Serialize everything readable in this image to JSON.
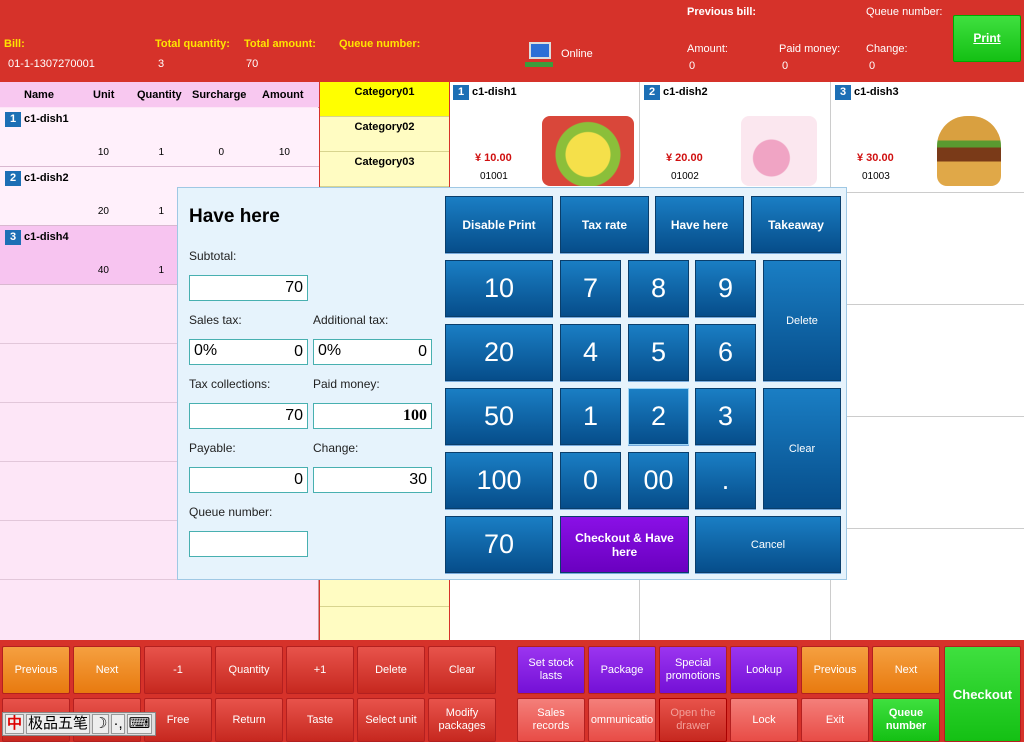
{
  "header": {
    "bill_label": "Bill:",
    "bill_value": "01-1-1307270001",
    "total_quantity_label": "Total quantity:",
    "total_quantity_value": "3",
    "total_amount_label": "Total amount:",
    "total_amount_value": "70",
    "queue_number_label": "Queue number:",
    "status": "Online",
    "previous_bill_label": "Previous bill:",
    "prev_queue_label": "Queue number:",
    "amount_label": "Amount:",
    "amount_value": "0",
    "paid_label": "Paid money:",
    "paid_value": "0",
    "change_label": "Change:",
    "change_value": "0",
    "print_label": "Print"
  },
  "orders": {
    "columns": [
      "Name",
      "Unit",
      "Quantity",
      "Surcharge",
      "Amount"
    ],
    "rows": [
      {
        "index": "1",
        "name": "c1-dish1",
        "unit": "10",
        "quantity": "1",
        "surcharge": "0",
        "amount": "10"
      },
      {
        "index": "2",
        "name": "c1-dish2",
        "unit": "20",
        "quantity": "1"
      },
      {
        "index": "3",
        "name": "c1-dish4",
        "unit": "40",
        "quantity": "1"
      }
    ]
  },
  "categories": [
    "Category01",
    "Category02",
    "Category03"
  ],
  "dishes": [
    {
      "index": "1",
      "name": "c1-dish1",
      "price": "¥ 10.00",
      "code": "01001"
    },
    {
      "index": "2",
      "name": "c1-dish2",
      "price": "¥ 20.00",
      "code": "01002"
    },
    {
      "index": "3",
      "name": "c1-dish3",
      "price": "¥ 30.00",
      "code": "01003"
    }
  ],
  "dialog": {
    "title": "Have here",
    "subtotal_label": "Subtotal:",
    "subtotal": "70",
    "sales_tax_label": "Sales tax:",
    "sales_tax_rate": "0%",
    "sales_tax": "0",
    "add_tax_label": "Additional tax:",
    "add_tax_rate": "0%",
    "add_tax": "0",
    "tax_coll_label": "Tax collections:",
    "tax_coll": "70",
    "paid_label": "Paid money:",
    "paid": "100",
    "payable_label": "Payable:",
    "payable": "0",
    "change_label": "Change:",
    "change": "30",
    "queue_label": "Queue number:",
    "queue": "",
    "top_buttons": [
      "Disable Print",
      "Tax rate",
      "Have here",
      "Takeaway"
    ],
    "quick": [
      "10",
      "20",
      "50",
      "100",
      "70"
    ],
    "keys": [
      "7",
      "8",
      "9",
      "4",
      "5",
      "6",
      "1",
      "2",
      "3",
      "0",
      "00",
      "."
    ],
    "delete": "Delete",
    "clear": "Clear",
    "checkout": "Checkout & Have here",
    "cancel": "Cancel"
  },
  "bottom": {
    "left_row1": [
      "Previous",
      "Next",
      "-1",
      "Quantity",
      "+1",
      "Delete",
      "Clear"
    ],
    "left_row2": [
      "Free",
      "Return",
      "Taste",
      "Select unit",
      "Modify packages"
    ],
    "right_row1": [
      "Set stock lasts",
      "Package",
      "Special promotions",
      "Lookup",
      "Previous",
      "Next"
    ],
    "right_row2": [
      "Sales records",
      "ommunicatio",
      "Open the drawer",
      "Lock",
      "Exit",
      "Queue number"
    ],
    "checkout": "Checkout",
    "ime": [
      "中",
      "极品五笔",
      "☽",
      "·,",
      "⌨"
    ]
  }
}
